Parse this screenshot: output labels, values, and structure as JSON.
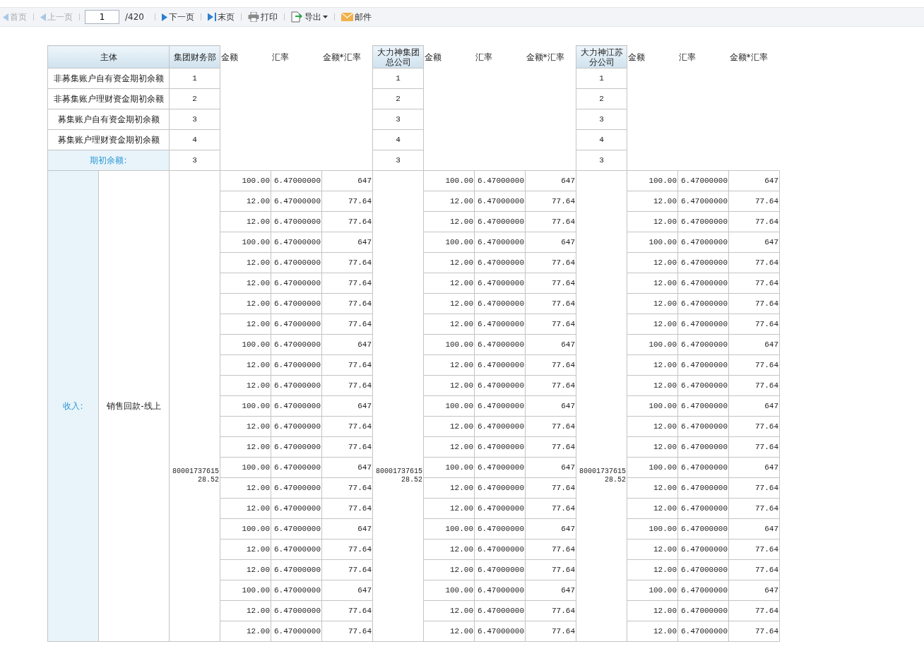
{
  "toolbar": {
    "buttons": [
      {
        "kind": "first",
        "label": "首页",
        "disabled": true
      },
      {
        "kind": "prev",
        "label": "上一页",
        "disabled": true
      },
      {
        "kind": "page",
        "value": "1",
        "total": "/420"
      },
      {
        "kind": "next",
        "label": "下一页",
        "disabled": false
      },
      {
        "kind": "last",
        "label": "末页",
        "disabled": false
      },
      {
        "kind": "print",
        "label": "打印",
        "disabled": false
      },
      {
        "kind": "export",
        "label": "导出",
        "disabled": false
      },
      {
        "kind": "mail",
        "label": "邮件",
        "disabled": false
      }
    ]
  },
  "table": {
    "entity_header": "主体",
    "row_labels": [
      "非募集账户自有资金期初余额",
      "非募集账户理财资金期初余额",
      "募集账户自有资金期初余额",
      "募集账户理财资金期初余额"
    ],
    "opening_label": "期初余额:",
    "section_label": "收入:",
    "category_label": "销售回款-线上",
    "companies": [
      {
        "name": "集团财务部",
        "columns": [
          "金额",
          "汇率",
          "金额*汇率"
        ],
        "summary": [
          "1",
          "2",
          "3",
          "4",
          "3"
        ],
        "total": "8000173761528.52",
        "rows": [
          [
            "100.00",
            "6.47000000",
            "647"
          ],
          [
            "12.00",
            "6.47000000",
            "77.64"
          ],
          [
            "12.00",
            "6.47000000",
            "77.64"
          ],
          [
            "100.00",
            "6.47000000",
            "647"
          ],
          [
            "12.00",
            "6.47000000",
            "77.64"
          ],
          [
            "12.00",
            "6.47000000",
            "77.64"
          ],
          [
            "12.00",
            "6.47000000",
            "77.64"
          ],
          [
            "12.00",
            "6.47000000",
            "77.64"
          ],
          [
            "100.00",
            "6.47000000",
            "647"
          ],
          [
            "12.00",
            "6.47000000",
            "77.64"
          ],
          [
            "12.00",
            "6.47000000",
            "77.64"
          ],
          [
            "100.00",
            "6.47000000",
            "647"
          ],
          [
            "12.00",
            "6.47000000",
            "77.64"
          ],
          [
            "12.00",
            "6.47000000",
            "77.64"
          ],
          [
            "100.00",
            "6.47000000",
            "647"
          ],
          [
            "12.00",
            "6.47000000",
            "77.64"
          ],
          [
            "12.00",
            "6.47000000",
            "77.64"
          ],
          [
            "100.00",
            "6.47000000",
            "647"
          ],
          [
            "12.00",
            "6.47000000",
            "77.64"
          ],
          [
            "12.00",
            "6.47000000",
            "77.64"
          ],
          [
            "100.00",
            "6.47000000",
            "647"
          ],
          [
            "12.00",
            "6.47000000",
            "77.64"
          ],
          [
            "12.00",
            "6.47000000",
            "77.64"
          ]
        ]
      },
      {
        "name": "大力神集团总公司",
        "columns": [
          "金额",
          "汇率",
          "金额*汇率"
        ],
        "summary": [
          "1",
          "2",
          "3",
          "4",
          "3"
        ],
        "total": "8000173761528.52",
        "rows": [
          [
            "100.00",
            "6.47000000",
            "647"
          ],
          [
            "12.00",
            "6.47000000",
            "77.64"
          ],
          [
            "12.00",
            "6.47000000",
            "77.64"
          ],
          [
            "100.00",
            "6.47000000",
            "647"
          ],
          [
            "12.00",
            "6.47000000",
            "77.64"
          ],
          [
            "12.00",
            "6.47000000",
            "77.64"
          ],
          [
            "12.00",
            "6.47000000",
            "77.64"
          ],
          [
            "12.00",
            "6.47000000",
            "77.64"
          ],
          [
            "100.00",
            "6.47000000",
            "647"
          ],
          [
            "12.00",
            "6.47000000",
            "77.64"
          ],
          [
            "12.00",
            "6.47000000",
            "77.64"
          ],
          [
            "100.00",
            "6.47000000",
            "647"
          ],
          [
            "12.00",
            "6.47000000",
            "77.64"
          ],
          [
            "12.00",
            "6.47000000",
            "77.64"
          ],
          [
            "100.00",
            "6.47000000",
            "647"
          ],
          [
            "12.00",
            "6.47000000",
            "77.64"
          ],
          [
            "12.00",
            "6.47000000",
            "77.64"
          ],
          [
            "100.00",
            "6.47000000",
            "647"
          ],
          [
            "12.00",
            "6.47000000",
            "77.64"
          ],
          [
            "12.00",
            "6.47000000",
            "77.64"
          ],
          [
            "100.00",
            "6.47000000",
            "647"
          ],
          [
            "12.00",
            "6.47000000",
            "77.64"
          ],
          [
            "12.00",
            "6.47000000",
            "77.64"
          ]
        ]
      },
      {
        "name": "大力神江苏分公司",
        "columns": [
          "金额",
          "汇率",
          "金额*汇率"
        ],
        "summary": [
          "1",
          "2",
          "3",
          "4",
          "3"
        ],
        "total": "8000173761528.52",
        "rows": [
          [
            "100.00",
            "6.47000000",
            "647"
          ],
          [
            "12.00",
            "6.47000000",
            "77.64"
          ],
          [
            "12.00",
            "6.47000000",
            "77.64"
          ],
          [
            "100.00",
            "6.47000000",
            "647"
          ],
          [
            "12.00",
            "6.47000000",
            "77.64"
          ],
          [
            "12.00",
            "6.47000000",
            "77.64"
          ],
          [
            "12.00",
            "6.47000000",
            "77.64"
          ],
          [
            "12.00",
            "6.47000000",
            "77.64"
          ],
          [
            "100.00",
            "6.47000000",
            "647"
          ],
          [
            "12.00",
            "6.47000000",
            "77.64"
          ],
          [
            "12.00",
            "6.47000000",
            "77.64"
          ],
          [
            "100.00",
            "6.47000000",
            "647"
          ],
          [
            "12.00",
            "6.47000000",
            "77.64"
          ],
          [
            "12.00",
            "6.47000000",
            "77.64"
          ],
          [
            "100.00",
            "6.47000000",
            "647"
          ],
          [
            "12.00",
            "6.47000000",
            "77.64"
          ],
          [
            "12.00",
            "6.47000000",
            "77.64"
          ],
          [
            "100.00",
            "6.47000000",
            "647"
          ],
          [
            "12.00",
            "6.47000000",
            "77.64"
          ],
          [
            "12.00",
            "6.47000000",
            "77.64"
          ],
          [
            "100.00",
            "6.47000000",
            "647"
          ],
          [
            "12.00",
            "6.47000000",
            "77.64"
          ],
          [
            "12.00",
            "6.47000000",
            "77.64"
          ]
        ]
      }
    ]
  }
}
